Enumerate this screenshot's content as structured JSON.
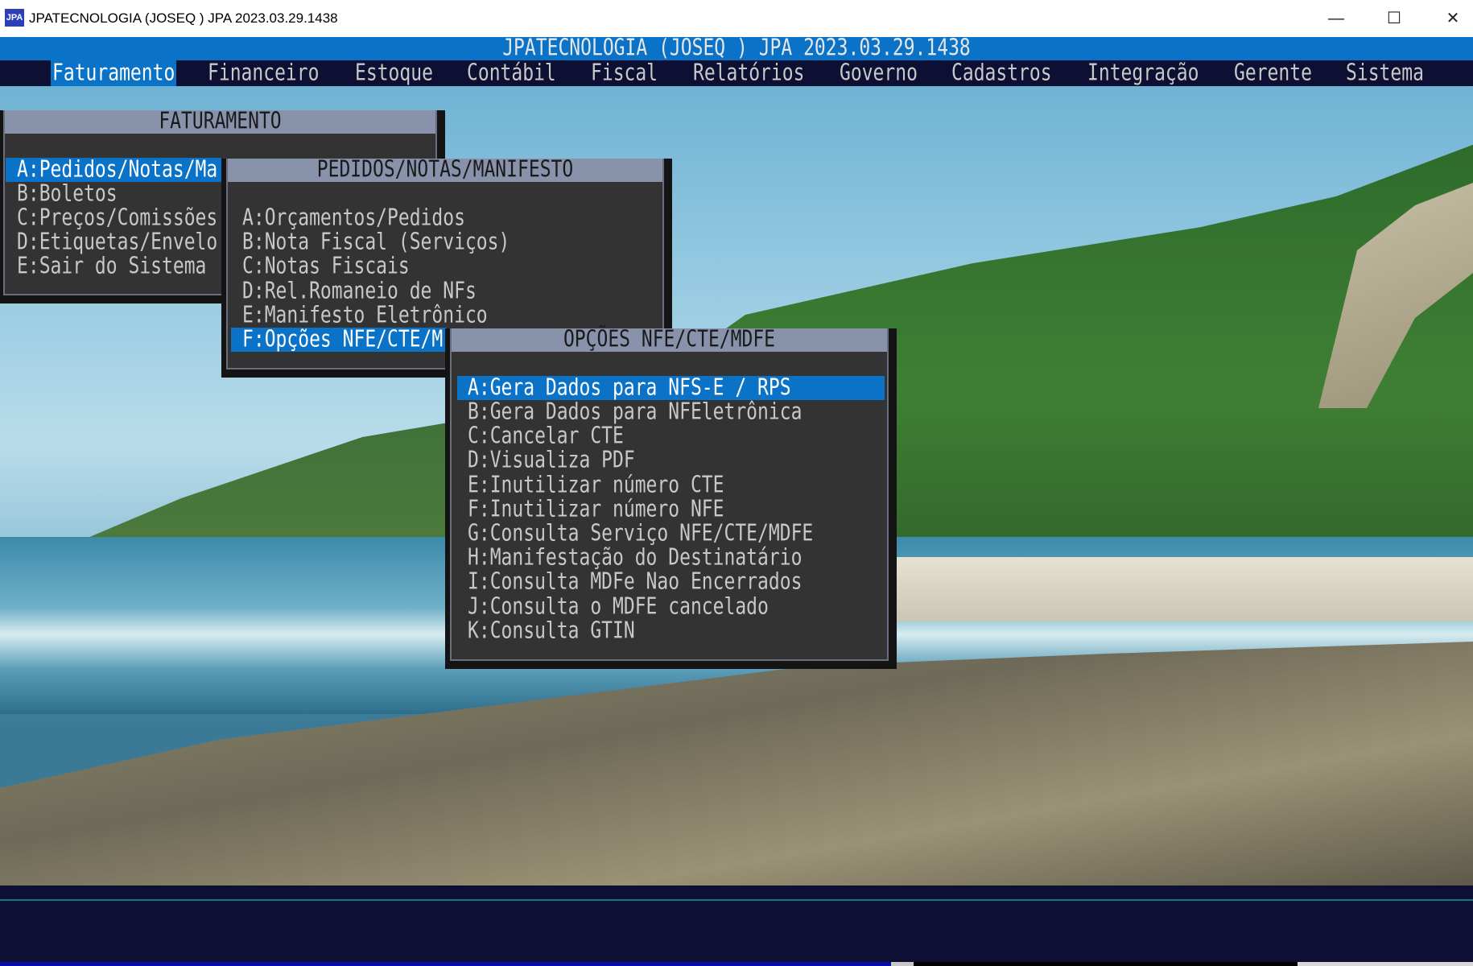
{
  "window": {
    "title": "JPATECNOLOGIA (JOSEQ ) JPA 2023.03.29.1438",
    "icon": "JPA"
  },
  "header": {
    "title": "JPATECNOLOGIA (JOSEQ ) JPA 2023.03.29.1438"
  },
  "menu": [
    "Faturamento",
    "Financeiro",
    "Estoque",
    "Contábil",
    "Fiscal",
    "Relatórios",
    "Governo",
    "Cadastros",
    "Integração",
    "Gerente",
    "Sistema"
  ],
  "faturamento": {
    "title": "FATURAMENTO",
    "items": [
      "A:Pedidos/Notas/Ma",
      "B:Boletos",
      "C:Preços/Comissões",
      "D:Etiquetas/Envelo",
      "E:Sair do Sistema"
    ]
  },
  "pedidos": {
    "title": "PEDIDOS/NOTAS/MANIFESTO",
    "items": [
      "A:Orçamentos/Pedidos",
      "B:Nota Fiscal (Serviços)",
      "C:Notas Fiscais",
      "D:Rel.Romaneio de NFs",
      "E:Manifesto Eletrônico",
      "F:Opções NFE/CTE/M"
    ]
  },
  "opcoes": {
    "title": "OPÇÕES NFE/CTE/MDFE",
    "items": [
      "A:Gera Dados para NFS-E / RPS",
      "B:Gera Dados para NFEletrônica",
      "C:Cancelar CTE",
      "D:Visualiza PDF",
      "E:Inutilizar número CTE",
      "F:Inutilizar número NFE",
      "G:Consulta Serviço NFE/CTE/MDFE",
      "H:Manifestação do Destinatário",
      "I:Consulta MDFe Nao Encerrados",
      "J:Consulta o MDFE cancelado",
      "K:Consulta GTIN"
    ]
  },
  "colors": {
    "accent": "#0a73c8",
    "menubar": "#0d0f33",
    "panel": "#333333",
    "panel_title": "#8893ab"
  }
}
